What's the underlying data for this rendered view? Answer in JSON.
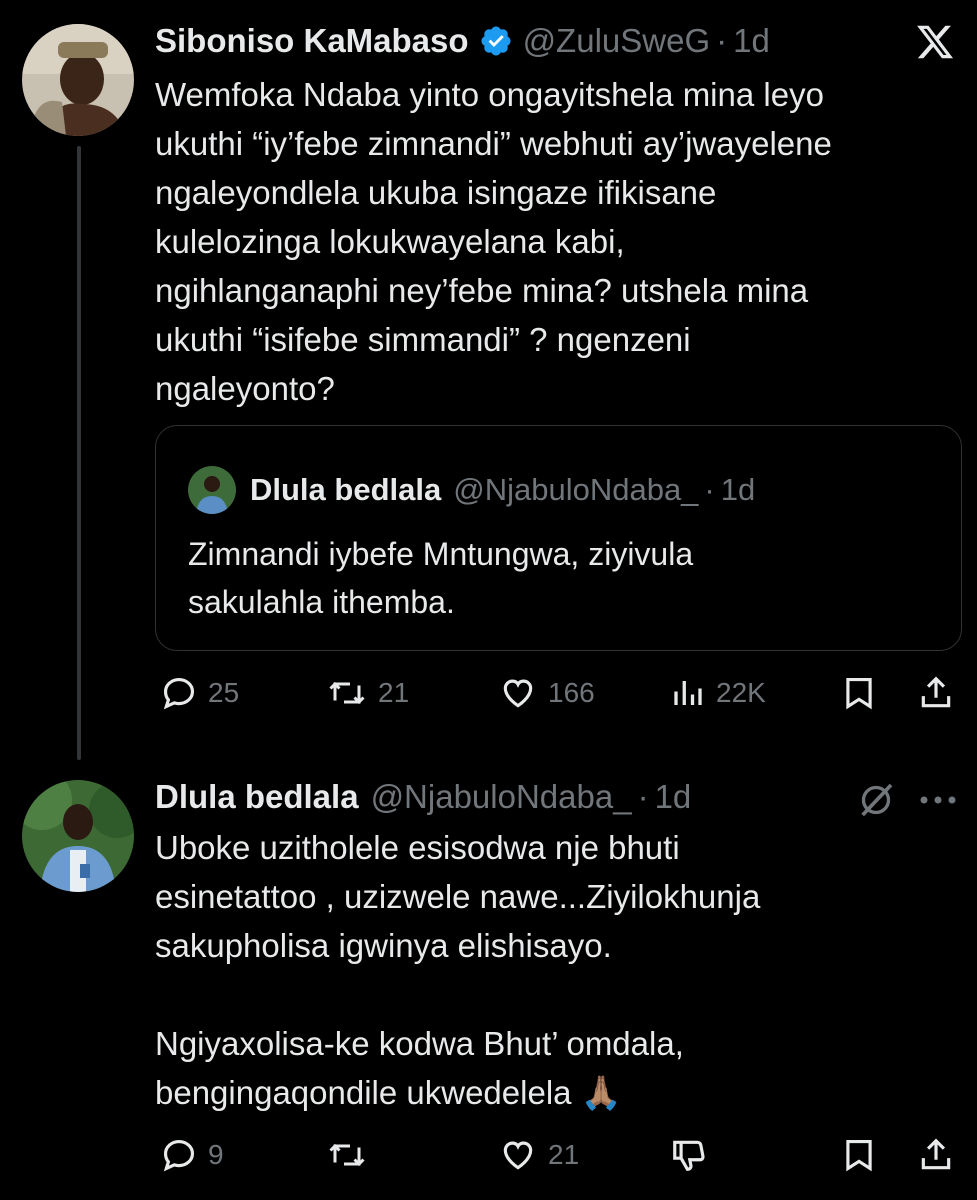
{
  "tweet1": {
    "name": "Siboniso KaMabaso",
    "handle": "@ZuluSweG",
    "dot": "·",
    "time": "1d",
    "text": "Wemfoka Ndaba yinto ongayitshela mina leyo\nukuthi “iy’febe zimnandi” webhuti ay’jwayelene\nngaleyondlela ukuba isingaze ifikisane\nkulelozinga lokukwayelana kabi,\nngihlanganaphi ney’febe mina? utshela mina\nukuthi “isifebe simmandi” ? ngenzeni\nngaleyonto?",
    "quote": {
      "name": "Dlula bedlala",
      "handle": "@NjabuloNdaba_",
      "dot": "·",
      "time": "1d",
      "text": "Zimnandi iybefe Mntungwa, ziyivula\nsakulahla ithemba."
    },
    "actions": {
      "replies": "25",
      "reposts": "21",
      "likes": "166",
      "views": "22K"
    }
  },
  "tweet2": {
    "name": "Dlula bedlala",
    "handle": "@NjabuloNdaba_",
    "dot": "·",
    "time": "1d",
    "text": "Uboke uzitholele esisodwa nje bhuti\nesinetattoo , uzizwele nawe...Ziyilokhunja\nsakupholisa igwinya elishisayo.\n\nNgiyaxolisa-ke kodwa Bhut’ omdala,\nbengingaqondile ukwedelela 🙏🏽",
    "actions": {
      "replies": "9",
      "reposts": "",
      "likes": "21"
    }
  },
  "icons": {
    "logo": "x-logo-icon",
    "verified": "verified-badge-icon",
    "reply": "reply-icon",
    "repost": "repost-icon",
    "like": "like-icon",
    "views": "views-icon",
    "bookmark": "bookmark-icon",
    "share": "share-icon",
    "grok": "grok-icon",
    "more": "more-icon",
    "dislike": "downvote-icon"
  },
  "colors": {
    "background": "#000000",
    "text": "#e7e9ea",
    "muted": "#71767b",
    "verified": "#1d9bf0",
    "border": "#2f3336"
  }
}
